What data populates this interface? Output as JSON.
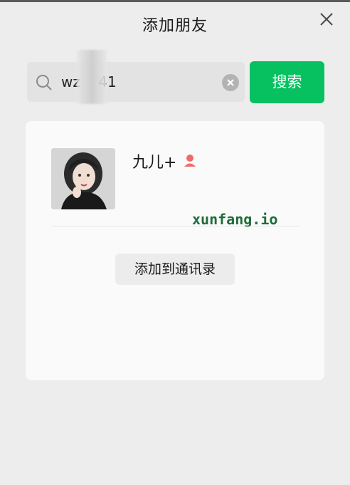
{
  "window": {
    "title": "添加朋友"
  },
  "search": {
    "value": "wz    41",
    "button_label": "搜索",
    "icon": "search-icon",
    "clear_icon": "clear-icon"
  },
  "result": {
    "nickname": "九儿+",
    "gender_icon": "female-icon",
    "watermark": "xunfang.io",
    "add_button_label": "添加到通讯录"
  },
  "colors": {
    "accent": "#07c160",
    "background": "#ededed",
    "card": "#fafafa",
    "female": "#f06a6a"
  }
}
